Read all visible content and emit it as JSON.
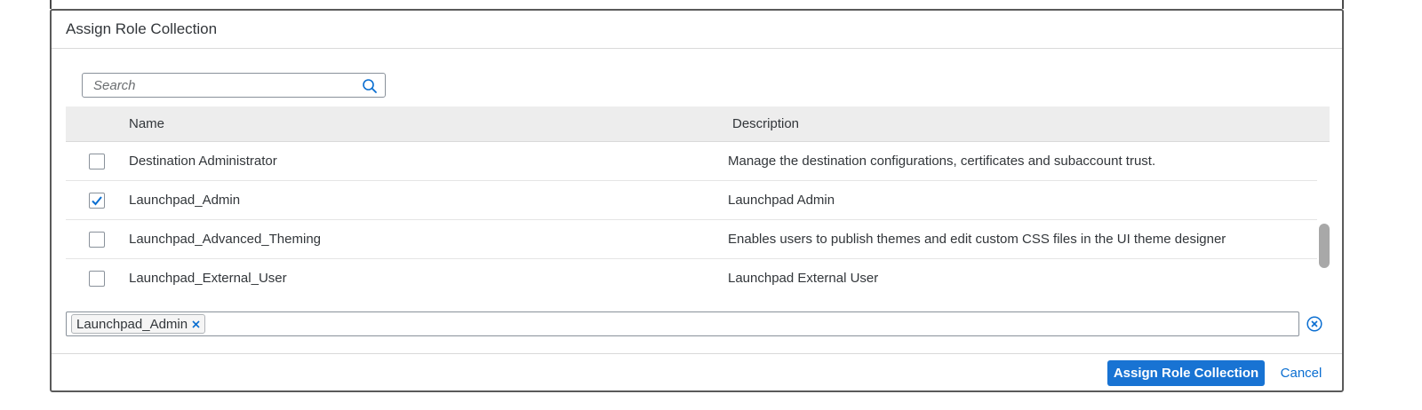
{
  "dialog": {
    "title": "Assign Role Collection"
  },
  "search": {
    "placeholder": "Search",
    "value": "",
    "icon": "search-icon"
  },
  "table": {
    "columns": [
      "Name",
      "Description"
    ],
    "rows": [
      {
        "checked": false,
        "name": "Destination Administrator",
        "description": "Manage the destination configurations, certificates and subaccount trust."
      },
      {
        "checked": true,
        "name": "Launchpad_Admin",
        "description": "Launchpad Admin"
      },
      {
        "checked": false,
        "name": "Launchpad_Advanced_Theming",
        "description": "Enables users to publish themes and edit custom CSS files in the UI theme designer"
      },
      {
        "checked": false,
        "name": "Launchpad_External_User",
        "description": "Launchpad External User"
      }
    ]
  },
  "selection": {
    "tokens": [
      "Launchpad_Admin"
    ],
    "token_remove_icon": "close-icon",
    "clear_icon": "clear-circle-icon"
  },
  "footer": {
    "primary_label": "Assign Role Collection",
    "cancel_label": "Cancel"
  },
  "colors": {
    "accent": "#1873d3",
    "link": "#0a6ed1",
    "header_bg": "#ededed"
  }
}
